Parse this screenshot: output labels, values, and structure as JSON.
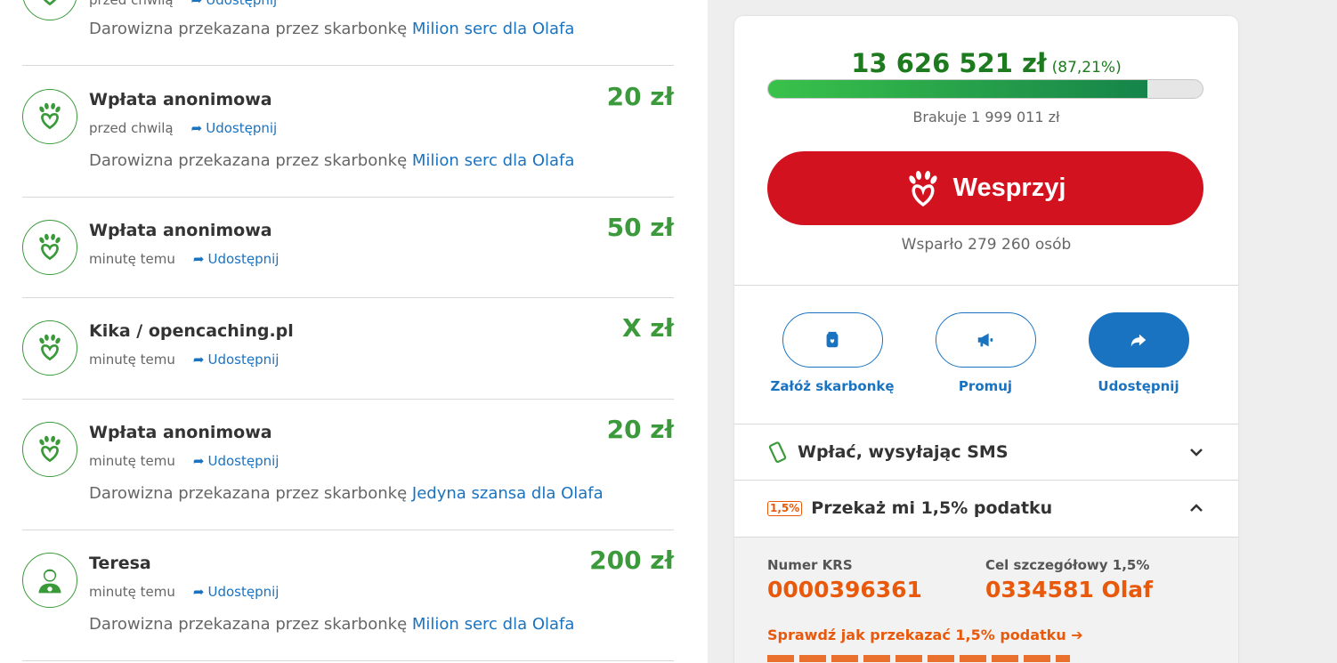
{
  "feed": {
    "share_label": "Udostępnij",
    "note_prefix": "Darowizna przekazana przez skarbonkę",
    "entries": [
      {
        "donor": "",
        "time": "przed chwilą",
        "note_link": "Milion serc dla Olafa",
        "amount": ""
      },
      {
        "donor": "Wpłata anonimowa",
        "time": "przed chwilą",
        "note_link": "Milion serc dla Olafa",
        "amount": "20 zł"
      },
      {
        "donor": "Wpłata anonimowa",
        "time": "minutę temu",
        "note_link": "",
        "amount": "50 zł"
      },
      {
        "donor": "Kika / opencaching.pl",
        "time": "minutę temu",
        "note_link": "",
        "amount": "X zł"
      },
      {
        "donor": "Wpłata anonimowa",
        "time": "minutę temu",
        "note_link": "Jedyna szansa dla Olafa",
        "amount": "20 zł"
      },
      {
        "donor": "Teresa",
        "time": "minutę temu",
        "note_link": "Milion serc dla Olafa",
        "amount": "200 zł"
      }
    ]
  },
  "campaign": {
    "raised": "13 626 521 zł",
    "percent_label": "(87,21%)",
    "progress": 0.8721,
    "missing": "Brakuje 1 999 011 zł",
    "support_button": "Wesprzyj",
    "supporters": "Wsparło 279 260 osób"
  },
  "actions": [
    {
      "label": "Załóż skarbonkę",
      "icon": "piggy-bank-icon"
    },
    {
      "label": "Promuj",
      "icon": "megaphone-icon"
    },
    {
      "label": "Udostępnij",
      "icon": "share-icon"
    }
  ],
  "sms": {
    "title": "Wpłać, wysyłając SMS",
    "icon": "phone-icon"
  },
  "tax": {
    "badge": "1,5%",
    "title": "Przekaż mi 1,5% podatku",
    "krs_label": "Numer KRS",
    "krs_value": "0000396361",
    "goal_label": "Cel szczegółowy 1,5%",
    "goal_value": "0334581 Olaf",
    "how_link": "Sprawdź jak przekazać 1,5% podatku"
  },
  "colors": {
    "brand_red": "#d3121f",
    "green": "#3c9a3c",
    "link_blue": "#1a73c1",
    "tax_orange": "#e8590c"
  }
}
